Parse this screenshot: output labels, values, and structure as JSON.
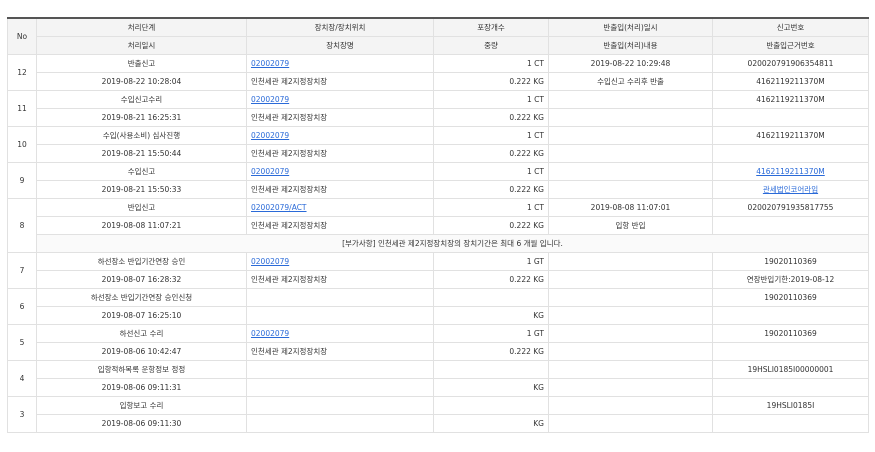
{
  "headers": {
    "row1": [
      "No",
      "처리단계",
      "장치장/장치위치",
      "포장개수",
      "반출입(처리)일시",
      "신고번호"
    ],
    "row2": [
      "처리일시",
      "장치장명",
      "중량",
      "반출입(처리)내용",
      "반출입근거번호"
    ]
  },
  "rows": [
    {
      "no": "12",
      "stage": "반출신고",
      "loc_code": "02002079",
      "pkg": "1 CT",
      "io_dt": "2019-08-22 10:29:48",
      "report_no": "020020791906354811",
      "proc_dt": "2019-08-22 10:28:04",
      "loc_name": "인천세관 제2지정장치장",
      "weight": "0.222 KG",
      "io_desc": "수입신고 수리후 반출",
      "basis_no": "4162119211370M"
    },
    {
      "no": "11",
      "stage": "수입신고수리",
      "loc_code": "02002079",
      "pkg": "1 CT",
      "io_dt": "",
      "report_no": "4162119211370M",
      "proc_dt": "2019-08-21 16:25:31",
      "loc_name": "인천세관 제2지정장치장",
      "weight": "0.222 KG",
      "io_desc": "",
      "basis_no": ""
    },
    {
      "no": "10",
      "stage": "수입(사용소비) 심사진행",
      "loc_code": "02002079",
      "pkg": "1 CT",
      "io_dt": "",
      "report_no": "4162119211370M",
      "proc_dt": "2019-08-21 15:50:44",
      "loc_name": "인천세관 제2지정장치장",
      "weight": "0.222 KG",
      "io_desc": "",
      "basis_no": ""
    },
    {
      "no": "9",
      "stage": "수입신고",
      "loc_code": "02002079",
      "pkg": "1 CT",
      "io_dt": "",
      "report_no": "4162119211370M",
      "proc_dt": "2019-08-21 15:50:33",
      "loc_name": "인천세관 제2지정장치장",
      "weight": "0.222 KG",
      "io_desc": "",
      "basis_no": "관세법인코어라임"
    },
    {
      "no": "8",
      "stage": "반입신고",
      "loc_code": "02002079/ACT",
      "pkg": "1 CT",
      "io_dt": "2019-08-08 11:07:01",
      "report_no": "020020791935817755",
      "proc_dt": "2019-08-08 11:07:21",
      "loc_name": "인천세관 제2지정장치장",
      "weight": "0.222 KG",
      "io_desc": "입항 반입",
      "basis_no": "",
      "note": "[부가사항] 인천세관 제2지정장치장의 장치기간은 최대 6 개월 입니다."
    },
    {
      "no": "7",
      "stage": "하선장소 반입기간연장 승인",
      "loc_code": "02002079",
      "pkg": "1 GT",
      "io_dt": "",
      "report_no": "19020110369",
      "proc_dt": "2019-08-07 16:28:32",
      "loc_name": "인천세관 제2지정장치장",
      "weight": "0.222 KG",
      "io_desc": "",
      "basis_no": "연장반입기한:2019-08-12"
    },
    {
      "no": "6",
      "stage": "하선장소 반입기간연장 승인신청",
      "loc_code": "",
      "pkg": "",
      "io_dt": "",
      "report_no": "19020110369",
      "proc_dt": "2019-08-07 16:25:10",
      "loc_name": "",
      "weight": "KG",
      "io_desc": "",
      "basis_no": ""
    },
    {
      "no": "5",
      "stage": "하선신고 수리",
      "loc_code": "02002079",
      "pkg": "1 GT",
      "io_dt": "",
      "report_no": "19020110369",
      "proc_dt": "2019-08-06 10:42:47",
      "loc_name": "인천세관 제2지정장치장",
      "weight": "0.222 KG",
      "io_desc": "",
      "basis_no": ""
    },
    {
      "no": "4",
      "stage": "입항적하목록 운항정보 정정",
      "loc_code": "",
      "pkg": "",
      "io_dt": "",
      "report_no": "19HSLI0185I00000001",
      "proc_dt": "2019-08-06 09:11:31",
      "loc_name": "",
      "weight": "KG",
      "io_desc": "",
      "basis_no": ""
    },
    {
      "no": "3",
      "stage": "입항보고 수리",
      "loc_code": "",
      "pkg": "",
      "io_dt": "",
      "report_no": "19HSLI0185I",
      "proc_dt": "2019-08-06 09:11:30",
      "loc_name": "",
      "weight": "KG",
      "io_desc": "",
      "basis_no": ""
    }
  ]
}
